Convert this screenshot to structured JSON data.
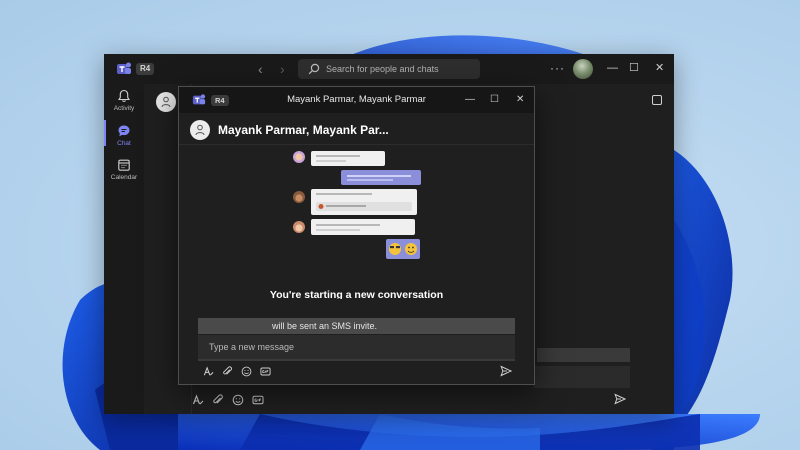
{
  "main_window": {
    "ring_label": "R4",
    "search_placeholder": "Search for people and chats",
    "nav": {
      "back_glyph": "‹",
      "forward_glyph": "›"
    },
    "more_glyph": "···",
    "controls": {
      "minimize": "—",
      "maximize": "☐",
      "close": "✕"
    },
    "rail": [
      {
        "label": "Activity",
        "icon": "bell-icon"
      },
      {
        "label": "Chat",
        "icon": "chat-icon",
        "active": true
      },
      {
        "label": "Calendar",
        "icon": "calendar-icon"
      }
    ]
  },
  "popout": {
    "ring_label": "R4",
    "title": "Mayank Parmar, Mayank Parmar",
    "header_name": "Mayank Parmar, Mayank Par...",
    "start_message": "You're starting a new conversation",
    "sms_notice": "will be sent an SMS invite.",
    "compose_placeholder": "Type a new message",
    "controls": {
      "minimize": "—",
      "maximize": "☐",
      "close": "✕"
    },
    "toolbar_icons": [
      "format-icon",
      "attach-icon",
      "emoji-icon",
      "gif-icon"
    ],
    "send_icon": "send-icon"
  },
  "colors": {
    "accent": "#7f85f5",
    "teams_purple": "#5b5fc7",
    "window_bg": "#1f1f1f",
    "titlebar_bg": "#1a1a1a"
  }
}
